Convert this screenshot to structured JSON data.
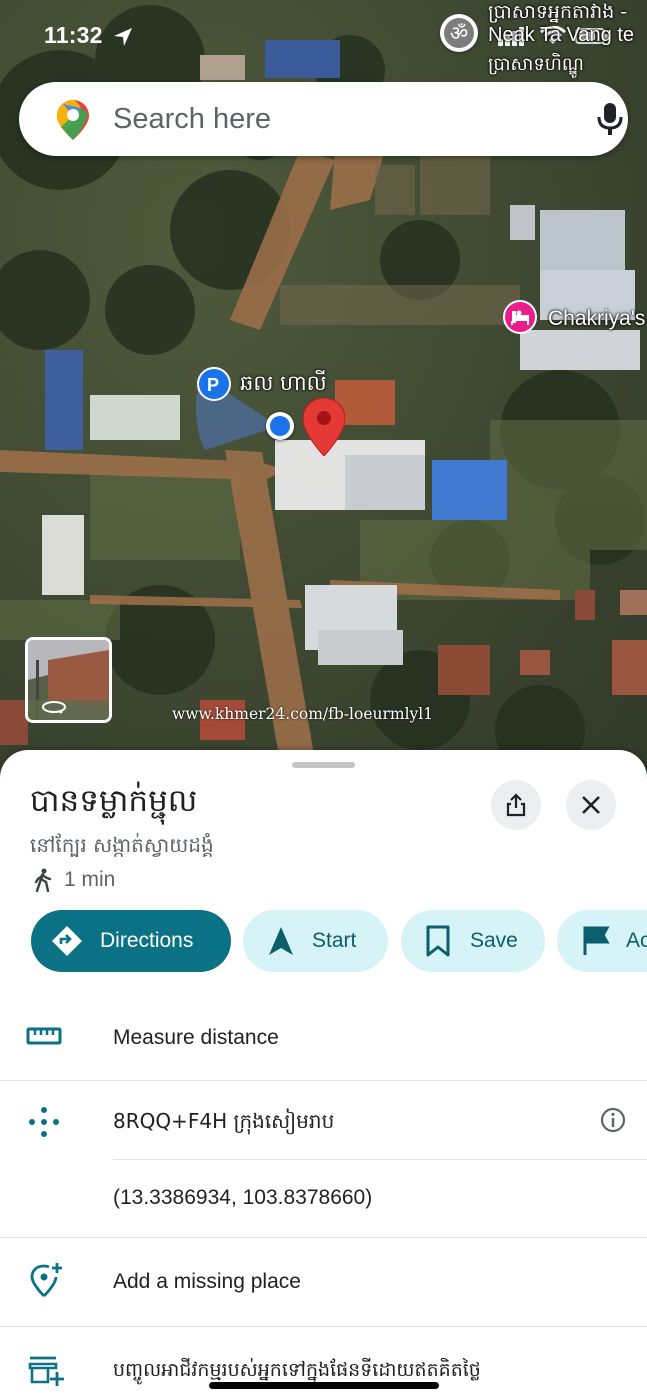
{
  "status_bar": {
    "time": "11:32"
  },
  "map": {
    "top_right_label_line1": "ប្រាសាទអ្នកតាវាង -",
    "top_right_label_line2": "Neak Ta Vang te",
    "top_right_label_line3": "ប្រាសាទហិណ្ឌូ",
    "parking_label": "ឆល ហាលី",
    "hotel_label": "Chakriya's",
    "watermark": "www.khmer24.com/fb-loeurmlyl1"
  },
  "search": {
    "placeholder": "Search here"
  },
  "place": {
    "title": "បានទម្លាក់ម្ជុល",
    "subtitle": "នៅក្បែរ សង្កាត់ស្វាយដង្គំ",
    "walk_time": "1 min"
  },
  "actions": [
    {
      "label": "Directions",
      "icon": "directions-icon"
    },
    {
      "label": "Start",
      "icon": "navigation-arrow-icon"
    },
    {
      "label": "Save",
      "icon": "bookmark-icon"
    },
    {
      "label": "Ac",
      "icon": "flag-icon"
    }
  ],
  "rows": {
    "measure": "Measure distance",
    "plus_code": "8RQQ+F4H ក្រុងសៀមរាប",
    "coordinates": "(13.3386934, 103.8378660)",
    "add_place": "Add a missing place",
    "add_business": "បញ្ចូលអាជីវកម្មរបស់អ្នកទៅក្នុងផែនទីដោយឥតគិតថ្លៃ"
  },
  "colors": {
    "primary_teal": "#0b7285",
    "chip_light": "#d6f3f7",
    "pin_red": "#e53935",
    "location_blue": "#1a73e8",
    "hotel_pink": "#e91e8c"
  }
}
